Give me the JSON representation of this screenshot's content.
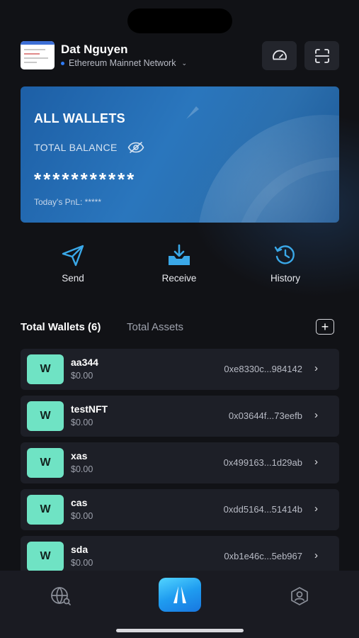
{
  "header": {
    "user_name": "Dat Nguyen",
    "network": "Ethereum Mainnet Network",
    "icons": {
      "speed": "speedometer-icon",
      "scan": "scan-icon",
      "network_chevron": "chevron-down-icon"
    }
  },
  "card": {
    "title": "ALL WALLETS",
    "balance_label": "TOTAL BALANCE",
    "balance_value": "***********",
    "pnl": "Today's PnL: *****"
  },
  "actions": [
    {
      "label": "Send",
      "icon": "send-icon"
    },
    {
      "label": "Receive",
      "icon": "receive-icon"
    },
    {
      "label": "History",
      "icon": "history-icon"
    }
  ],
  "list": {
    "tab_wallets": "Total Wallets (6)",
    "tab_assets": "Total Assets",
    "add_label": "+"
  },
  "wallets": [
    {
      "icon_letter": "W",
      "name": "aa344",
      "balance": "$0.00",
      "address": "0xe8330c...984142"
    },
    {
      "icon_letter": "W",
      "name": "testNFT",
      "balance": "$0.00",
      "address": "0x03644f...73eefb"
    },
    {
      "icon_letter": "W",
      "name": "xas",
      "balance": "$0.00",
      "address": "0x499163...1d29ab"
    },
    {
      "icon_letter": "W",
      "name": "cas",
      "balance": "$0.00",
      "address": "0xdd5164...51414b"
    },
    {
      "icon_letter": "W",
      "name": "sda",
      "balance": "$0.00",
      "address": "0xb1e46c...5eb967"
    }
  ],
  "colors": {
    "background": "#111216",
    "card": "#2a76bd",
    "accent": "#3aa8e8",
    "wallet_icon": "#6fe3c4",
    "row": "#1d1f27"
  }
}
